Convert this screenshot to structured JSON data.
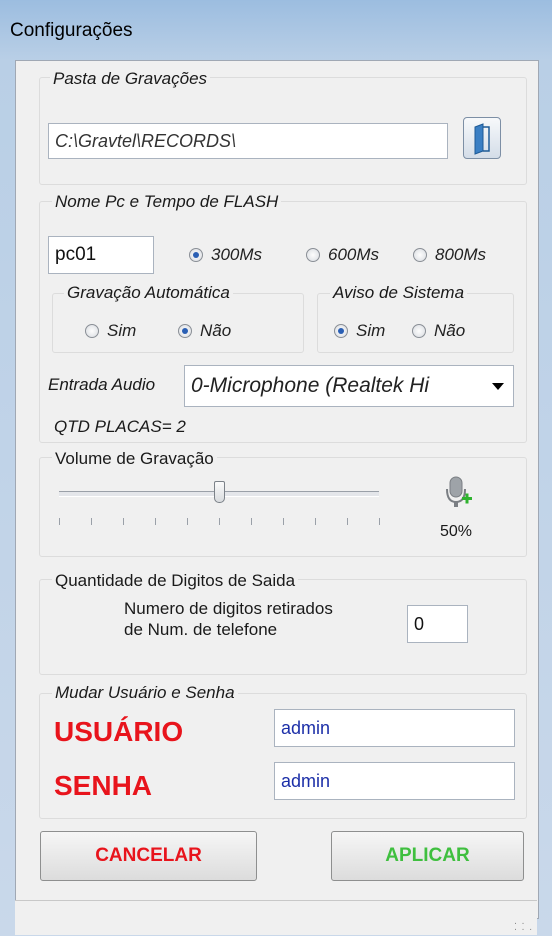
{
  "window": {
    "title": "Configurações"
  },
  "recordings": {
    "group_label": "Pasta de Gravações",
    "path": "C:\\Gravtel\\RECORDS\\"
  },
  "pc_flash": {
    "group_label": "Nome Pc e Tempo de FLASH",
    "pc_name": "pc01",
    "options": [
      {
        "label": "300Ms",
        "selected": true
      },
      {
        "label": "600Ms",
        "selected": false
      },
      {
        "label": "800Ms",
        "selected": false
      }
    ]
  },
  "auto_record": {
    "group_label": "Gravação Automática",
    "yes": "Sim",
    "no": "Não",
    "selected": "Não"
  },
  "system_notice": {
    "group_label": "Aviso de Sistema",
    "yes": "Sim",
    "no": "Não",
    "selected": "Sim"
  },
  "audio_input": {
    "label": "Entrada Audio",
    "selected": "0-Microphone (Realtek Hi"
  },
  "qtd_placas": "QTD PLACAS= 2",
  "volume": {
    "group_label": "Volume de Gravação",
    "value_text": "50%",
    "level": 0.5,
    "ticks": 11
  },
  "digits": {
    "group_label": "Quantidade de Digitos de Saida",
    "line1": "Numero de digitos retirados",
    "line2": "de Num. de telefone",
    "value": "0"
  },
  "credentials": {
    "group_label": "Mudar Usuário e Senha",
    "user_label": "USUÁRIO",
    "user_value": "admin",
    "pass_label": "SENHA",
    "pass_value": "admin"
  },
  "buttons": {
    "cancel": "CANCELAR",
    "apply": "APLICAR"
  },
  "colors": {
    "label_red": "#e8141c",
    "apply_green": "#3fbf3f",
    "input_text_blue": "#1c2fa8"
  },
  "icons": {
    "folder": "folder-icon",
    "microphone": "microphone-add-icon",
    "dropdown": "chevron-down-icon",
    "resize": "resize-grip-icon"
  }
}
